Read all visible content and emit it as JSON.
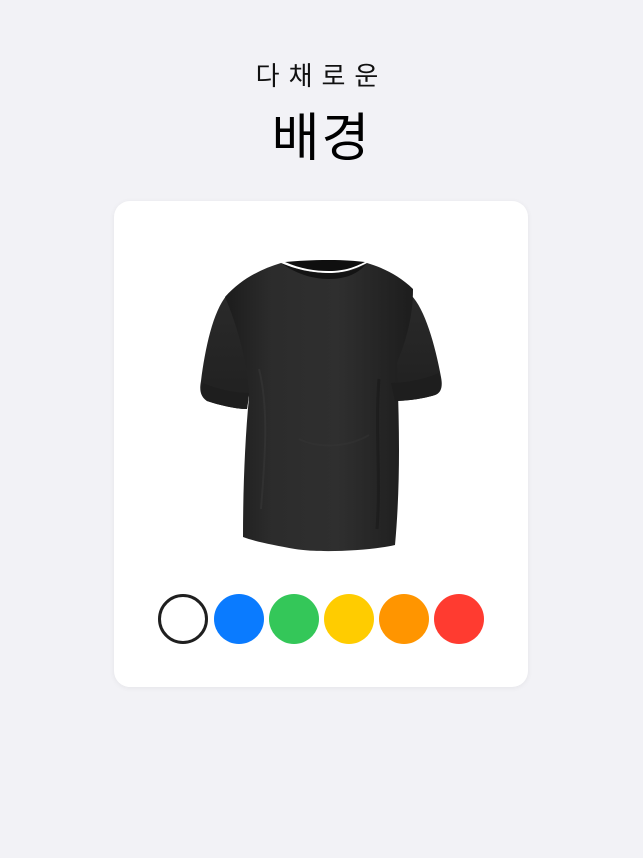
{
  "header": {
    "subtitle": "다채로운",
    "title": "배경"
  },
  "product": {
    "icon": "t-shirt-image",
    "color": "#2b2b2b"
  },
  "swatches": [
    {
      "name": "white",
      "color": "#ffffff",
      "selected": true
    },
    {
      "name": "blue",
      "color": "#0a7bff",
      "selected": false
    },
    {
      "name": "green",
      "color": "#34c759",
      "selected": false
    },
    {
      "name": "yellow",
      "color": "#ffcc00",
      "selected": false
    },
    {
      "name": "orange",
      "color": "#ff9500",
      "selected": false
    },
    {
      "name": "red",
      "color": "#ff3b30",
      "selected": false
    }
  ]
}
